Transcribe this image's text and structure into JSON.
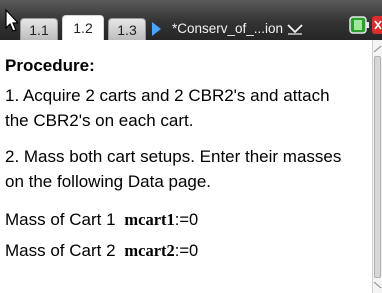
{
  "toolbar": {
    "tabs": [
      {
        "label": "1.1",
        "active": false
      },
      {
        "label": "1.2",
        "active": true
      },
      {
        "label": "1.3",
        "active": false
      }
    ],
    "document_title": "*Conserv_of_...ion",
    "icons": [
      "cursor-icon",
      "tab-arrow-icon",
      "chevron-down-icon",
      "battery-icon",
      "close-icon"
    ],
    "colors": {
      "bar": "#333333",
      "arrow": "#4aa3ff",
      "battery": "#2e9e2e",
      "close": "#d92e2e"
    }
  },
  "page": {
    "heading": "Procedure:",
    "step1_line1": "1. Acquire 2 carts and 2 CBR2's and attach",
    "step1_line2": "the CBR2's on each cart.",
    "step2_line1": "2. Mass both cart setups. Enter their masses",
    "step2_line2": "on the following Data page.",
    "var1_label": "Mass of Cart 1",
    "var1_name": "mcart1",
    "var1_assign": ":=0",
    "var2_label": "Mass of Cart 2",
    "var2_name": "mcart2",
    "var2_assign": ":=0"
  }
}
